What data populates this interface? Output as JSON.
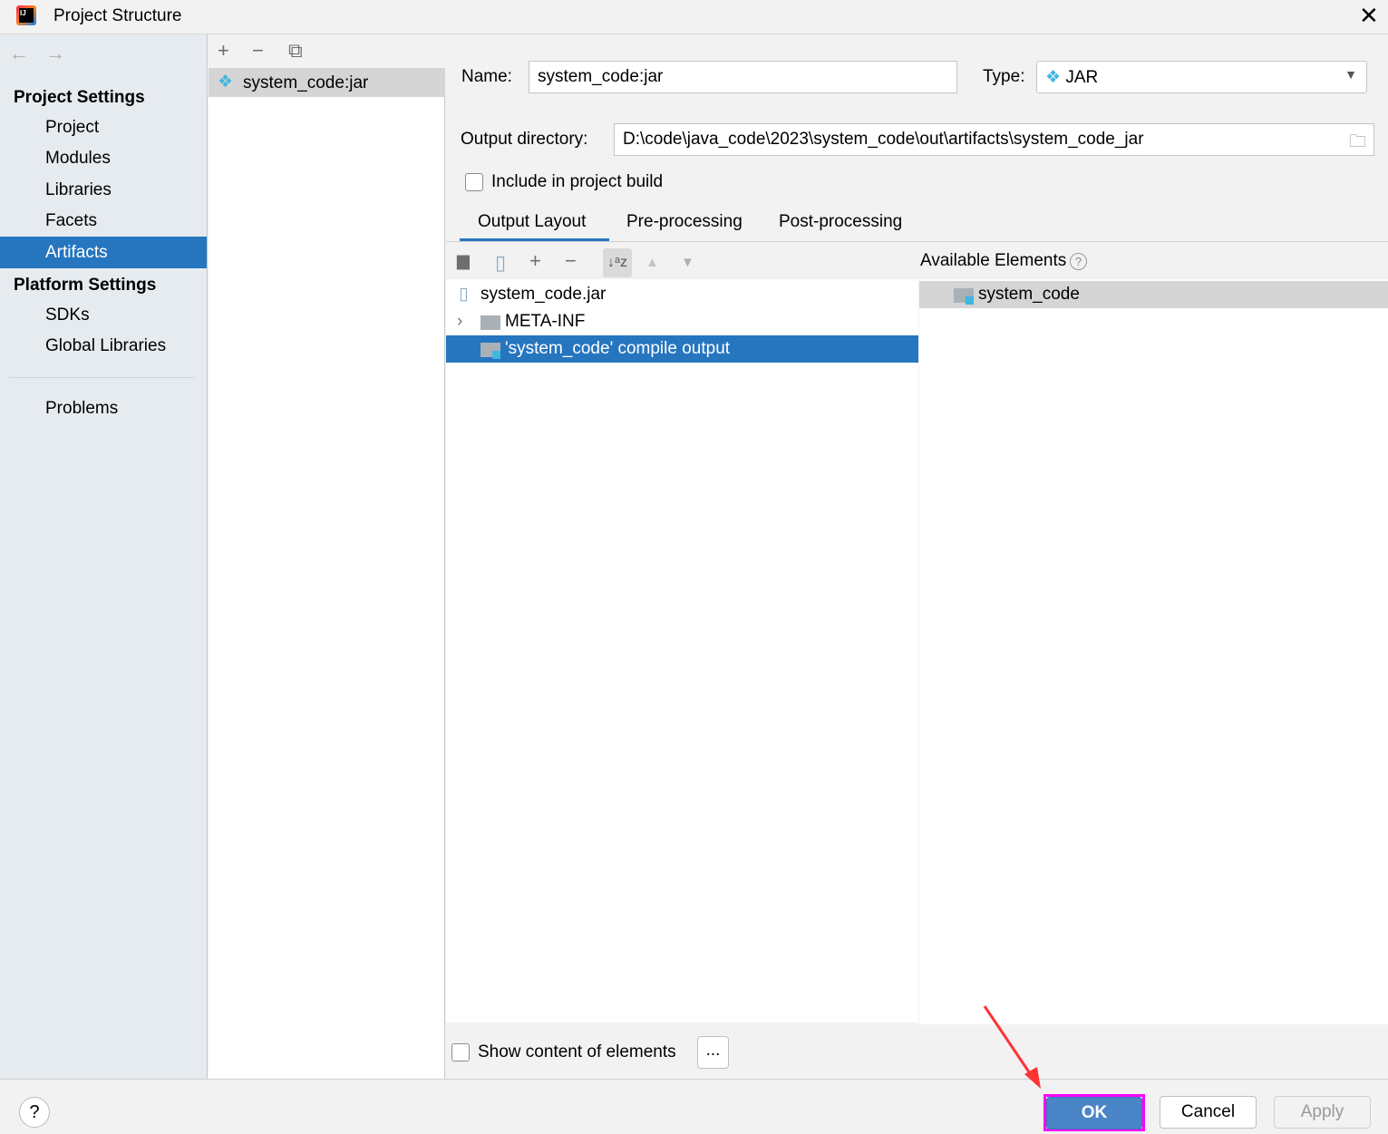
{
  "window": {
    "title": "Project Structure",
    "close_icon": "close-icon"
  },
  "sidebar": {
    "project_settings": "Project Settings",
    "items": [
      {
        "label": "Project"
      },
      {
        "label": "Modules"
      },
      {
        "label": "Libraries"
      },
      {
        "label": "Facets"
      },
      {
        "label": "Artifacts",
        "selected": true
      }
    ],
    "platform_settings": "Platform Settings",
    "platform_items": [
      {
        "label": "SDKs"
      },
      {
        "label": "Global Libraries"
      }
    ],
    "problems": "Problems"
  },
  "artifacts_list": {
    "items": [
      {
        "label": "system_code:jar",
        "selected": true
      }
    ]
  },
  "form": {
    "name_label": "Name:",
    "name_value": "system_code:jar",
    "type_label": "Type:",
    "type_value": "JAR",
    "output_dir_label": "Output directory:",
    "output_dir_value": "D:\\code\\java_code\\2023\\system_code\\out\\artifacts\\system_code_jar",
    "include_build_label": "Include in project build",
    "include_build_checked": false
  },
  "tabs": [
    {
      "label": "Output Layout",
      "active": true
    },
    {
      "label": "Pre-processing"
    },
    {
      "label": "Post-processing"
    }
  ],
  "layout_tree": [
    {
      "label": "system_code.jar",
      "icon": "jar-icon"
    },
    {
      "label": "META-INF",
      "icon": "folder-icon",
      "expandable": true
    },
    {
      "label": "'system_code' compile output",
      "icon": "module-output-icon",
      "selected": true
    }
  ],
  "available": {
    "title": "Available Elements",
    "items": [
      {
        "label": "system_code",
        "selected": true
      }
    ]
  },
  "show_content_label": "Show content of elements",
  "show_content_checked": false,
  "ellipsis_label": "...",
  "footer": {
    "ok": "OK",
    "cancel": "Cancel",
    "apply": "Apply",
    "help": "?"
  },
  "colors": {
    "selection": "#2675bf",
    "ok": "#4a86c7",
    "highlight": "#ff00ff",
    "arrow": "#ff3333"
  }
}
